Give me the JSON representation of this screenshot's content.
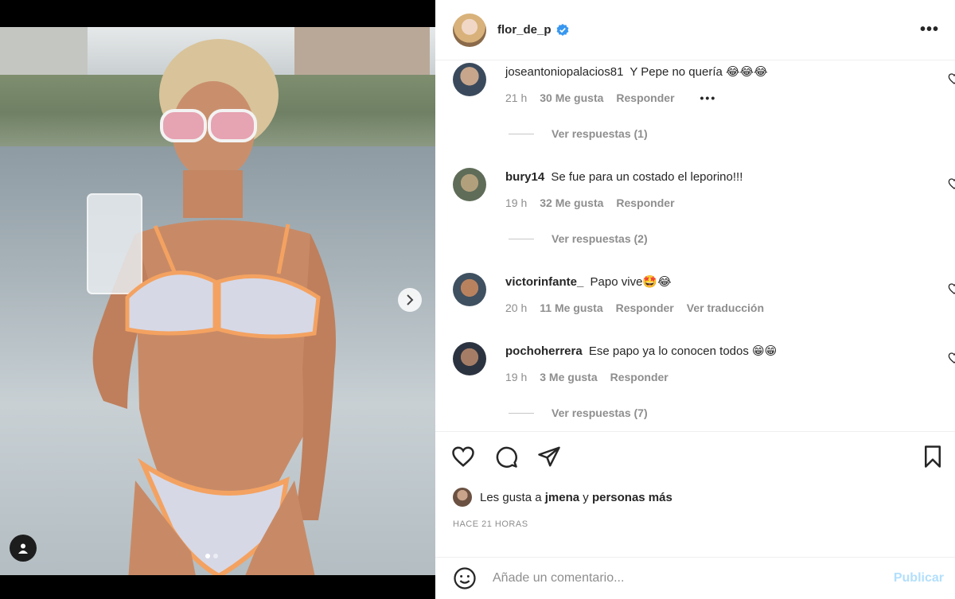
{
  "post": {
    "username": "flor_de_p",
    "verified": true,
    "more_label": "•••"
  },
  "media": {
    "carousel_dots": 2,
    "active_dot": 0,
    "next_icon": "chevron-right-icon",
    "user_tag_icon": "person-icon"
  },
  "comments": [
    {
      "user": "joseantoniopalacios81",
      "text": "Y Pepe no quería 😂😂😂",
      "time": "21 h",
      "likes": "30 Me gusta",
      "reply": "Responder",
      "extra": "•••",
      "replies": "Ver respuestas (1)"
    },
    {
      "user": "bury14",
      "text": "Se fue para un costado el leporino!!!",
      "time": "19 h",
      "likes": "32 Me gusta",
      "reply": "Responder",
      "replies": "Ver respuestas (2)"
    },
    {
      "user": "victorinfante_",
      "text": "Papo vive🤩😂",
      "time": "20 h",
      "likes": "11 Me gusta",
      "reply": "Responder",
      "translate": "Ver traducción"
    },
    {
      "user": "pochoherrera",
      "text": "Ese papo ya lo conocen todos 😁😁",
      "time": "19 h",
      "likes": "3 Me gusta",
      "reply": "Responder",
      "replies": "Ver respuestas (7)"
    }
  ],
  "likes_line": {
    "prefix": "Les gusta a",
    "user": "jmena",
    "connector": "y",
    "suffix": "personas más"
  },
  "timestamp": "HACE 21 HORAS",
  "composer": {
    "placeholder": "Añade un comentario...",
    "publish": "Publicar"
  },
  "colors": {
    "verified": "#3897f0",
    "muted": "#8e8e8e",
    "publish_disabled": "#b2dffc",
    "bikini_trim": "#f4a261"
  }
}
